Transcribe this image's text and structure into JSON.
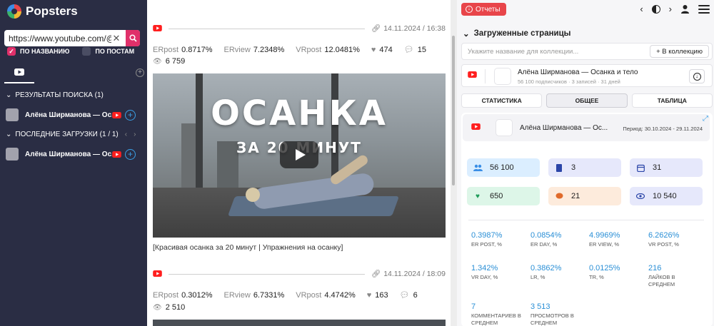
{
  "sidebar": {
    "brand": "Popsters",
    "search": {
      "value": "https://www.youtube.com/@sl",
      "placeholder": ""
    },
    "filters": {
      "by_name": "ПО НАЗВАНИЮ",
      "by_posts": "ПО ПОСТАМ"
    },
    "results_header": "РЕЗУЛЬТАТЫ ПОИСКА (1)",
    "results": [
      {
        "title": "Алёна Ширманова — Ос..."
      }
    ],
    "recent_header": "ПОСЛЕДНИЕ ЗАГРУЗКИ (1 / 1)",
    "recent": [
      {
        "title": "Алёна Ширманова — Ос..."
      }
    ]
  },
  "feed": {
    "posts": [
      {
        "date": "14.11.2024 / 16:38",
        "erpost_label": "ERpost",
        "erpost": "0.8717%",
        "erview_label": "ERview",
        "erview": "7.2348%",
        "vrpost_label": "VRpost",
        "vrpost": "12.0481%",
        "likes": "474",
        "comments": "15",
        "views": "6 759",
        "thumb_title": "ОСАНКА",
        "thumb_subtitle": "ЗА 20 МИНУТ",
        "caption": "[Красивая осанка за 20 минут | Упражнения на осанку]"
      },
      {
        "date": "14.11.2024 / 18:09",
        "erpost_label": "ERpost",
        "erpost": "0.3012%",
        "erview_label": "ERview",
        "erview": "6.7331%",
        "vrpost_label": "VRpost",
        "vrpost": "4.4742%",
        "likes": "163",
        "comments": "6",
        "views": "2 510"
      }
    ]
  },
  "panel": {
    "reports_btn": "Отчеты",
    "loaded_header": "Загруженные страницы",
    "collection_placeholder": "Укажите название для коллекции...",
    "collection_btn": "+ В коллекцию",
    "page": {
      "title": "Алёна Ширманова — Осанка и тело",
      "meta": "56 100 подписчиков · 3 записей · 31 дней"
    },
    "tabs": [
      "СТАТИСТИКА",
      "ОБЩЕЕ",
      "ТАБЛИЦА"
    ],
    "summary": {
      "title": "Алёна Ширманова — Ос...",
      "period": "Период: 30.10.2024 - 29.11.2024",
      "tiles": [
        {
          "icon": "subscribers-icon",
          "value": "56 100",
          "color": "#dbeeff"
        },
        {
          "icon": "posts-icon",
          "value": "3",
          "color": "#e6e8fb"
        },
        {
          "icon": "calendar-icon",
          "value": "31",
          "color": "#e6e8fb"
        },
        {
          "icon": "likes-icon",
          "value": "650",
          "color": "#ddf6e8"
        },
        {
          "icon": "comments-icon",
          "value": "21",
          "color": "#fdebdc"
        },
        {
          "icon": "views-icon",
          "value": "10 540",
          "color": "#e6e8fb"
        }
      ],
      "metrics": [
        {
          "value": "0.3987%",
          "label": "ER POST, %"
        },
        {
          "value": "0.0854%",
          "label": "ER DAY, %"
        },
        {
          "value": "4.9969%",
          "label": "ER VIEW, %"
        },
        {
          "value": "6.2626%",
          "label": "VR POST, %"
        },
        {
          "value": "1.342%",
          "label": "VR DAY, %"
        },
        {
          "value": "0.3862%",
          "label": "LR, %"
        },
        {
          "value": "0.0125%",
          "label": "TR, %"
        },
        {
          "value": "216",
          "label": "ЛАЙКОВ В СРЕДНЕМ"
        },
        {
          "value": "7",
          "label": "КОММЕНТАРИЕВ В СРЕДНЕМ"
        },
        {
          "value": "3 513",
          "label": "ПРОСМОТРОВ В СРЕДНЕМ"
        }
      ]
    }
  }
}
